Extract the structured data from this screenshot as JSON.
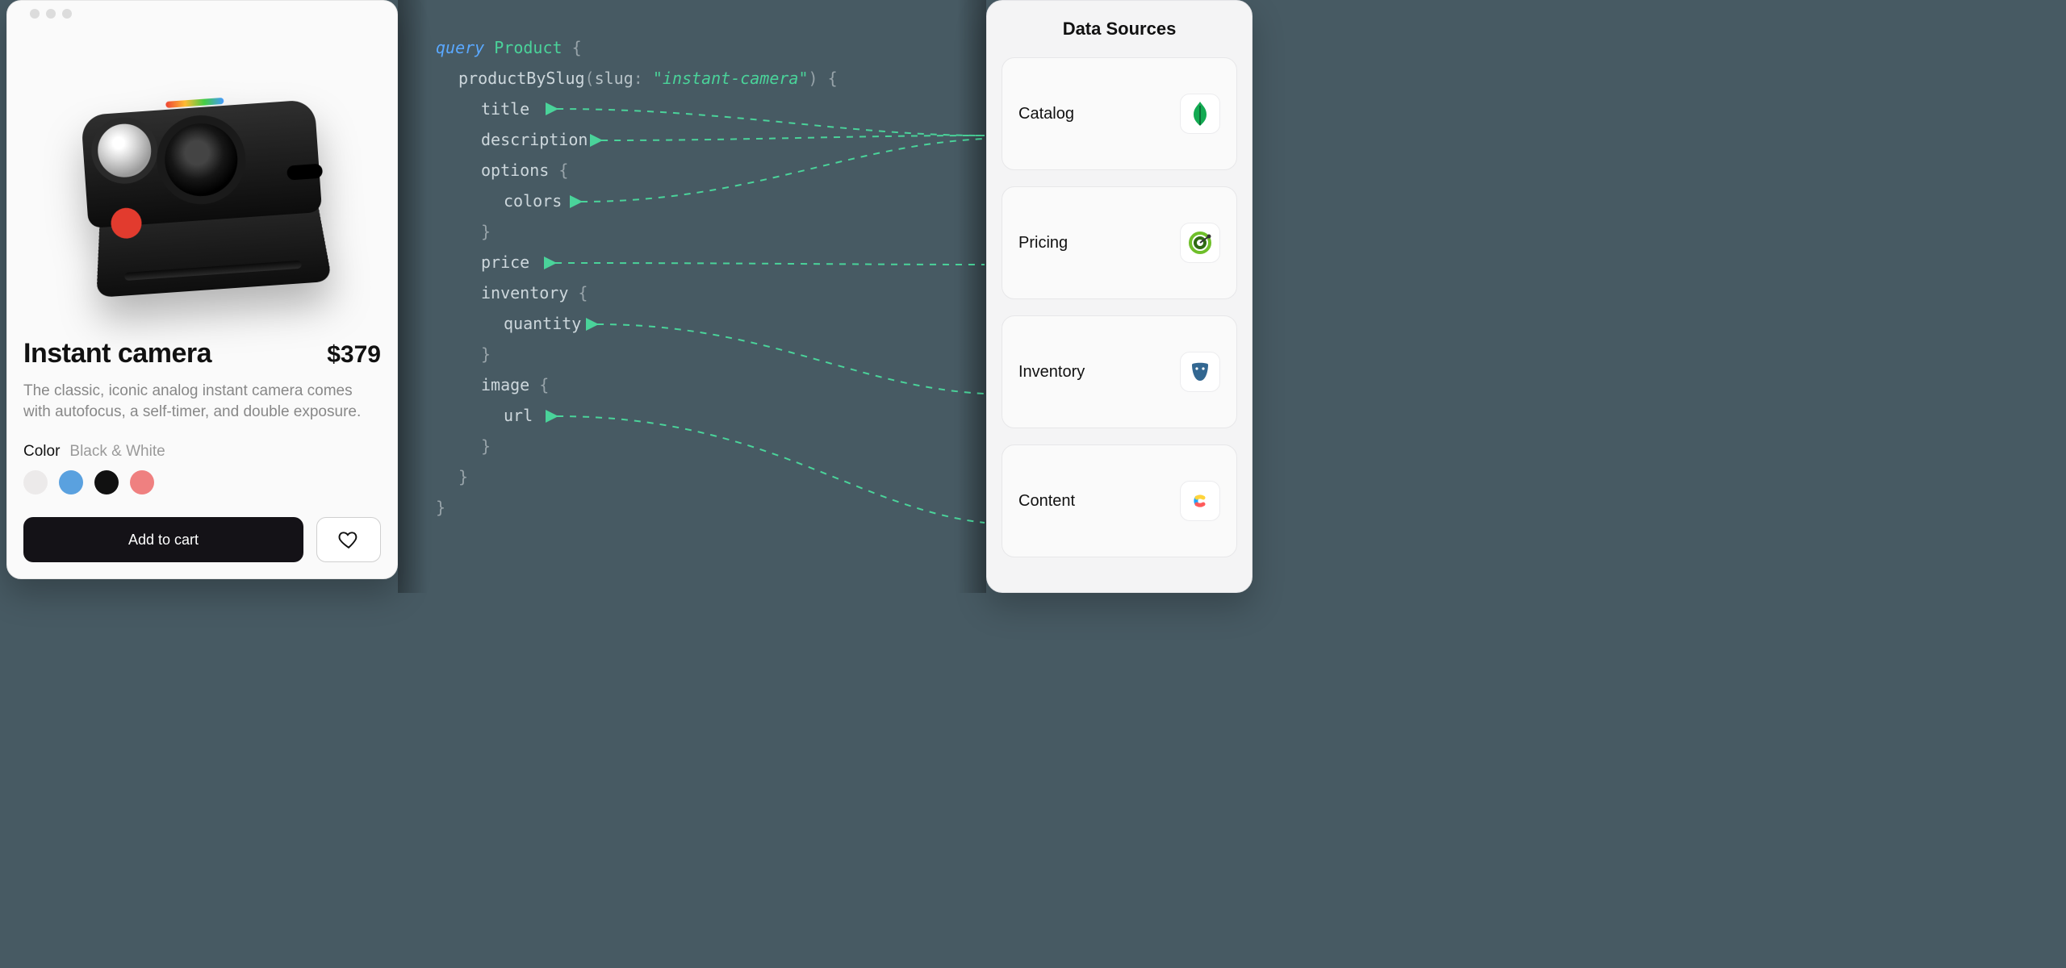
{
  "product": {
    "title": "Instant camera",
    "price": "$379",
    "description": "The classic, iconic analog instant camera comes with autofocus, a self-timer, and double exposure.",
    "option_label": "Color",
    "option_value": "Black & White",
    "swatches": [
      "#eceaea",
      "#5aa1df",
      "#111111",
      "#ef8080"
    ],
    "add_to_cart": "Add to cart"
  },
  "query": {
    "keyword": "query",
    "op_name": "Product",
    "root_field": "productBySlug",
    "arg_name": "slug",
    "arg_value": "\"instant-camera\"",
    "fields": {
      "title": "title",
      "description": "description",
      "options": "options",
      "colors": "colors",
      "price": "price",
      "inventory": "inventory",
      "quantity": "quantity",
      "image": "image",
      "url": "url"
    }
  },
  "sources": {
    "heading": "Data Sources",
    "items": [
      {
        "label": "Catalog",
        "icon": "mongodb-icon"
      },
      {
        "label": "Pricing",
        "icon": "radar-icon"
      },
      {
        "label": "Inventory",
        "icon": "postgres-icon"
      },
      {
        "label": "Content",
        "icon": "contentful-icon"
      }
    ]
  }
}
